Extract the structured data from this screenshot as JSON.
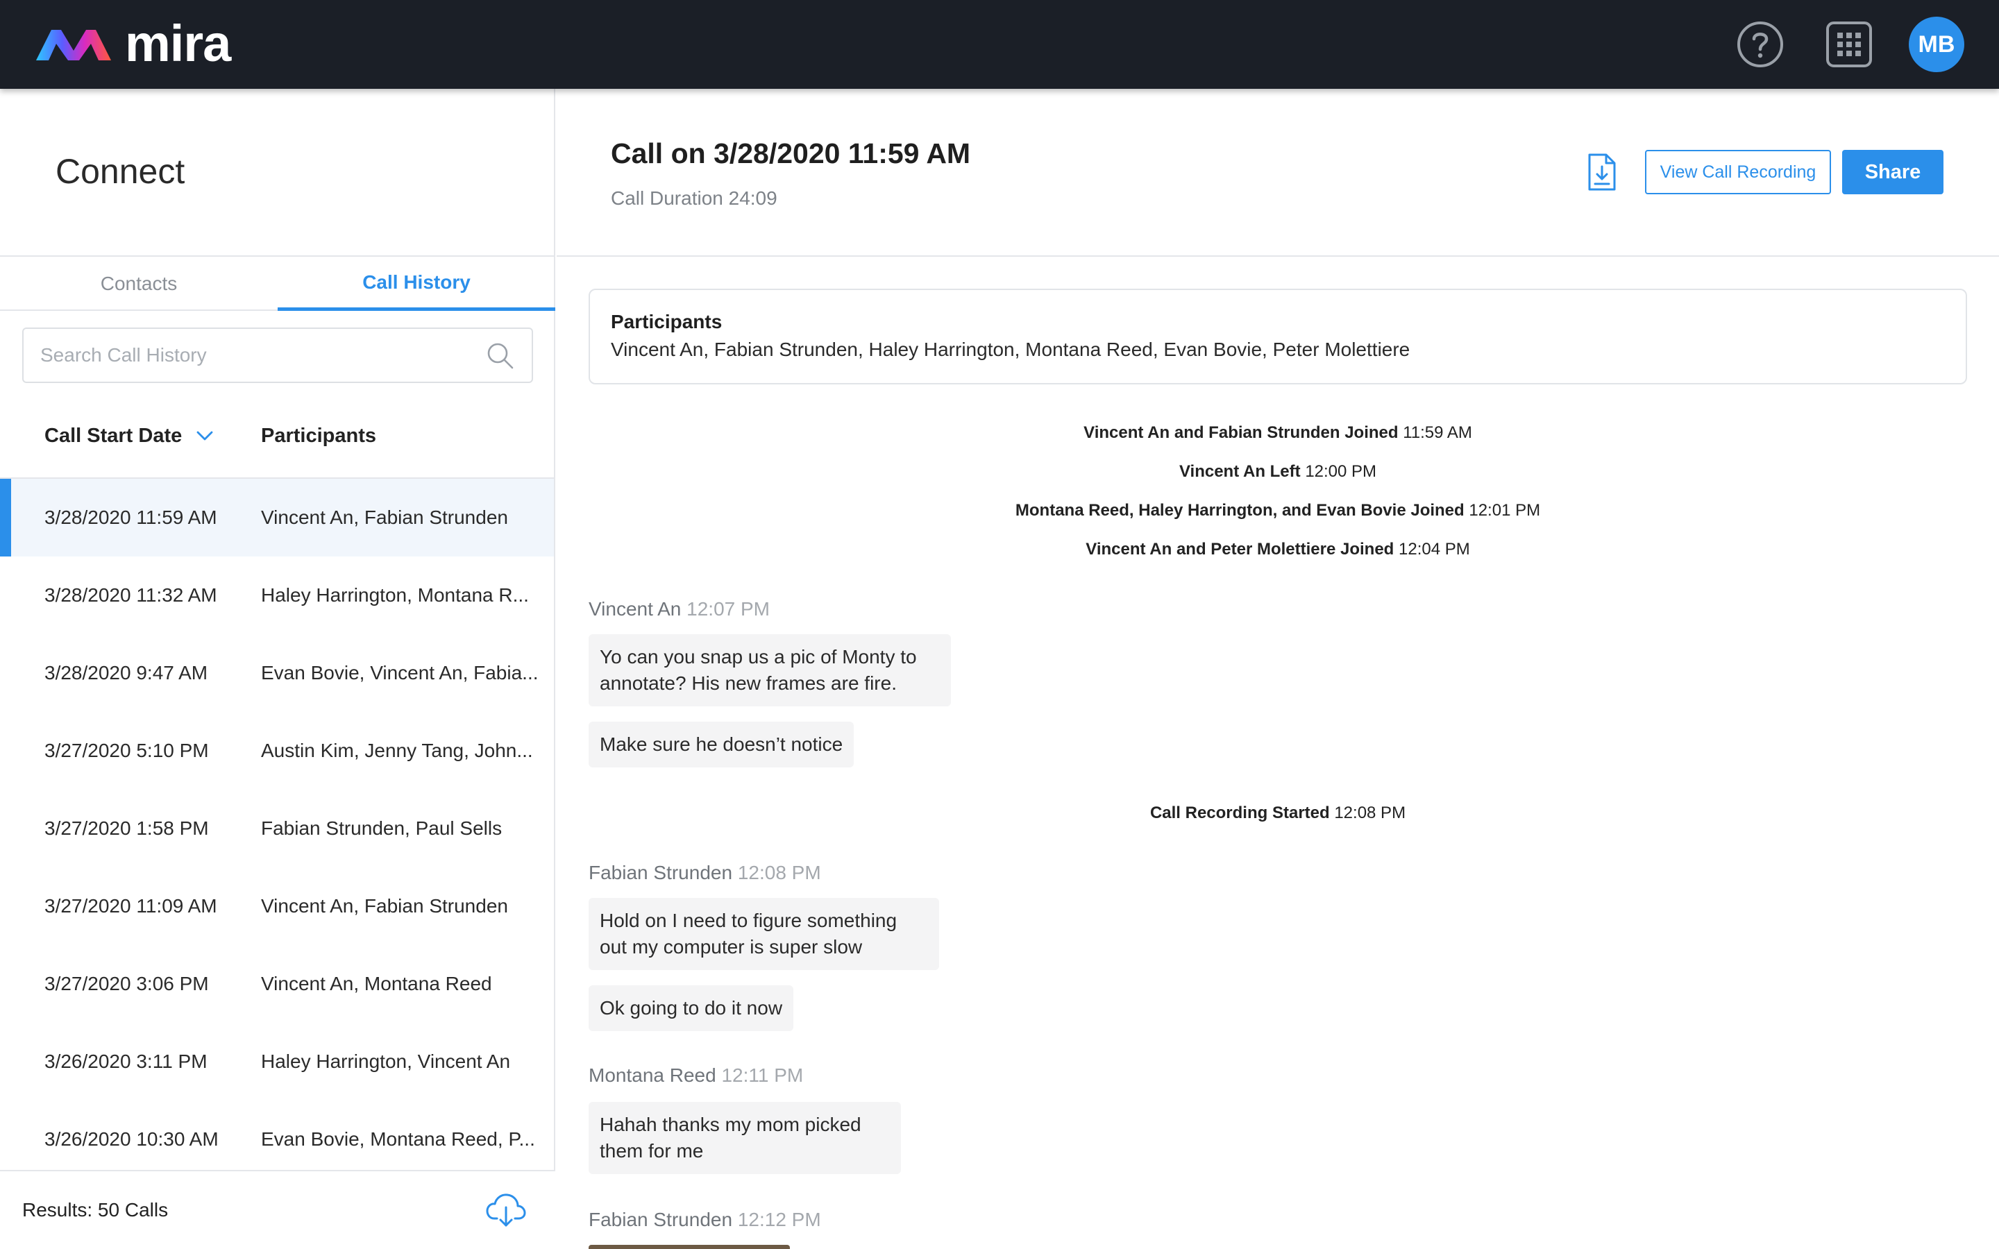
{
  "app": {
    "brand": "mira",
    "avatar_initials": "MB"
  },
  "sidebar": {
    "title": "Connect",
    "tabs": [
      {
        "label": "Contacts"
      },
      {
        "label": "Call History"
      }
    ],
    "search_placeholder": "Search Call History",
    "columns": {
      "date": "Call Start Date",
      "participants": "Participants"
    },
    "calls": [
      {
        "date": "3/28/2020 11:59 AM",
        "participants": "Vincent An, Fabian Strunden"
      },
      {
        "date": "3/28/2020 11:32 AM",
        "participants": "Haley Harrington, Montana R..."
      },
      {
        "date": "3/28/2020 9:47 AM",
        "participants": "Evan Bovie, Vincent An, Fabia..."
      },
      {
        "date": "3/27/2020 5:10 PM",
        "participants": "Austin Kim, Jenny Tang, John..."
      },
      {
        "date": "3/27/2020 1:58 PM",
        "participants": "Fabian Strunden, Paul Sells"
      },
      {
        "date": "3/27/2020 11:09 AM",
        "participants": "Vincent An, Fabian Strunden"
      },
      {
        "date": "3/27/2020 3:06 PM",
        "participants": "Vincent An, Montana Reed"
      },
      {
        "date": "3/26/2020 3:11 PM",
        "participants": "Haley Harrington, Vincent An"
      },
      {
        "date": "3/26/2020 10:30 AM",
        "participants": "Evan Bovie, Montana Reed, P..."
      }
    ],
    "results": "Results: 50 Calls"
  },
  "detail": {
    "title": "Call on 3/28/2020 11:59 AM",
    "duration": "Call Duration 24:09",
    "view_recording_label": "View Call Recording",
    "share_label": "Share",
    "participants_heading": "Participants",
    "participants_list": "Vincent An, Fabian Strunden, Haley Harrington, Montana Reed, Evan Bovie, Peter Molettiere",
    "events": [
      {
        "text": "Vincent An and Fabian Strunden Joined",
        "time": "11:59 AM"
      },
      {
        "text": "Vincent An Left",
        "time": "12:00 PM"
      },
      {
        "text": "Montana Reed, Haley Harrington, and Evan Bovie Joined",
        "time": "12:01 PM"
      },
      {
        "text": "Vincent An and Peter Molettiere Joined",
        "time": "12:04 PM"
      },
      {
        "text": "Call Recording Started",
        "time": "12:08 PM"
      }
    ],
    "messages": [
      {
        "sender": "Vincent An",
        "time": "12:07 PM",
        "bubbles": [
          "Yo can you snap us a pic of Monty to annotate? His new frames are fire.",
          "Make sure he doesn’t notice"
        ]
      },
      {
        "sender": "Fabian Strunden",
        "time": "12:08 PM",
        "bubbles": [
          "Hold on I need to figure something out my computer is super slow",
          "Ok going to do it now"
        ]
      },
      {
        "sender": "Montana Reed",
        "time": "12:11 PM",
        "bubbles": [
          "Hahah thanks my mom picked them for me"
        ]
      },
      {
        "sender": "Fabian Strunden",
        "time": "12:12 PM",
        "bubbles": []
      }
    ]
  },
  "colors": {
    "accent": "#2b8fea",
    "topbar": "#1b1f27",
    "bubble": "#f4f4f5",
    "selected_row": "#f1f6fc"
  },
  "icons": [
    "mira-logo-icon",
    "help-icon",
    "apps-grid-icon",
    "search-icon",
    "chevron-down-icon",
    "cloud-download-icon",
    "document-download-icon"
  ]
}
